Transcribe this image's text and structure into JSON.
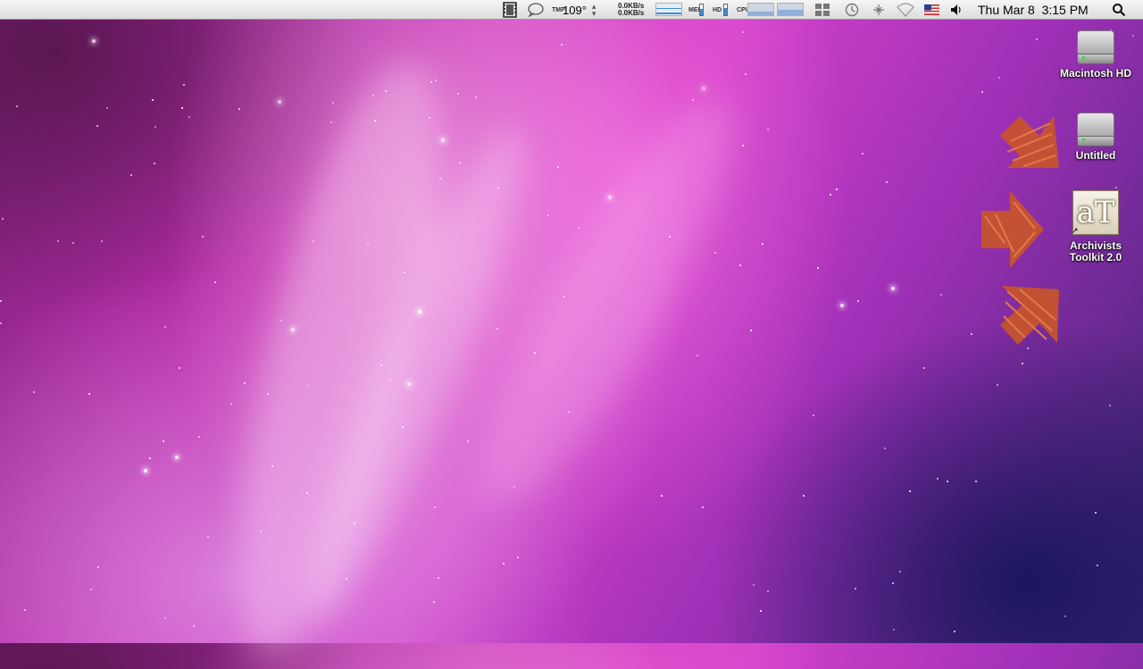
{
  "menubar": {
    "temp_label": "TMP",
    "temp_value": "109°",
    "net_up": "0.0KB/s",
    "net_down": "0.0KB/s",
    "mem_label": "MEM",
    "hd_label": "HD",
    "cpu_label": "CPU",
    "clock": "Thu Mar 8  3:15 PM",
    "icons": [
      "film-strip-icon",
      "speech-bubble-icon",
      "temperature-icon",
      "network-activity-icon",
      "memory-meter-icon",
      "disk-meter-icon",
      "cpu-meter-icon",
      "spaces-icon",
      "time-machine-icon",
      "bluetooth-icon",
      "wifi-icon",
      "us-flag-icon",
      "volume-icon",
      "spotlight-search-icon"
    ]
  },
  "desktop": {
    "icons": [
      {
        "label": "Macintosh HD",
        "icon": "hard-drive-icon"
      },
      {
        "label": "Untitled",
        "icon": "hard-drive-icon"
      },
      {
        "label": "Archivists Toolkit 2.0",
        "icon": "archivists-toolkit-app-icon",
        "app_glyph": "aT"
      }
    ],
    "annotation_arrows": [
      "arrow-pointing-to-untitled",
      "arrow-pointing-to-archivists-toolkit",
      "arrow-pointing-below-toolkit"
    ],
    "arrow_color": "#c8552a"
  }
}
